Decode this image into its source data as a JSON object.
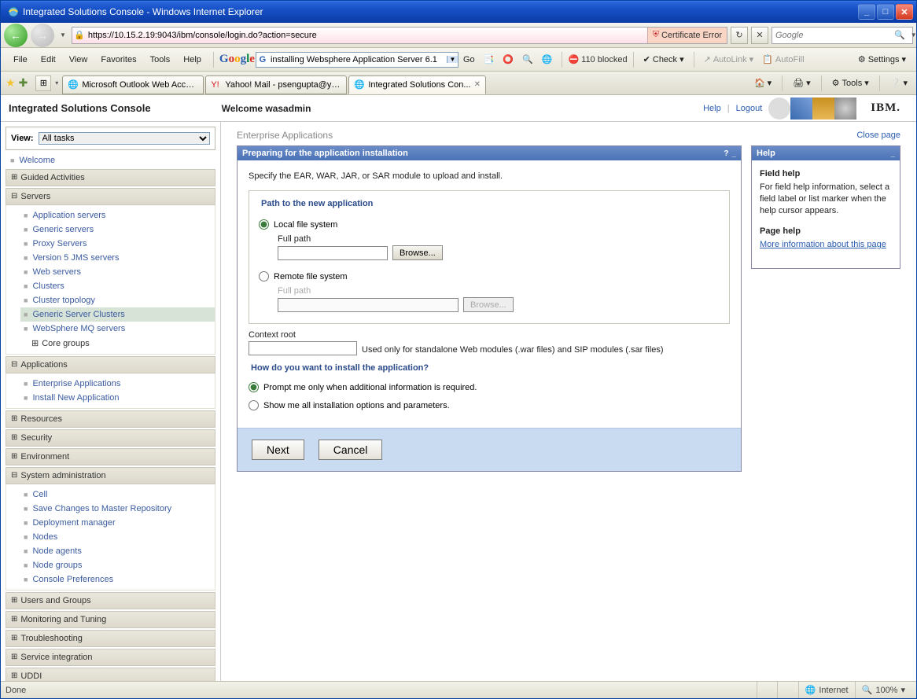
{
  "window": {
    "title": "Integrated Solutions Console - Windows Internet Explorer"
  },
  "address": {
    "url": "https://10.15.2.19:9043/ibm/console/login.do?action=secure",
    "cert_error": "Certificate Error",
    "search_placeholder": "Google"
  },
  "menubar": {
    "items": [
      "File",
      "Edit",
      "View",
      "Favorites",
      "Tools",
      "Help"
    ],
    "google_search_value": "installing Websphere Application Server 6.1",
    "go": "Go",
    "popup_count": "110 blocked",
    "check": "Check",
    "autolink": "AutoLink",
    "autofill": "AutoFill",
    "settings": "Settings"
  },
  "tabs": [
    {
      "label": "Microsoft Outlook Web Access"
    },
    {
      "label": "Yahoo! Mail - psengupta@ya..."
    },
    {
      "label": "Integrated Solutions Con..."
    }
  ],
  "tabs_tools": {
    "tools": "Tools"
  },
  "console": {
    "title": "Integrated Solutions Console",
    "welcome": "Welcome wasadmin",
    "help": "Help",
    "logout": "Logout",
    "ibm": "IBM."
  },
  "sidebar": {
    "view_label": "View:",
    "view_value": "All tasks",
    "welcome": "Welcome",
    "groups": {
      "guided": "Guided Activities",
      "servers": "Servers",
      "applications": "Applications",
      "resources": "Resources",
      "security": "Security",
      "environment": "Environment",
      "sysadmin": "System administration",
      "users_groups": "Users and Groups",
      "monitoring": "Monitoring and Tuning",
      "troubleshooting": "Troubleshooting",
      "service_integration": "Service integration",
      "uddi": "UDDI"
    },
    "servers_items": [
      "Application servers",
      "Generic servers",
      "Proxy Servers",
      "Version 5 JMS servers",
      "Web servers",
      "Clusters",
      "Cluster topology",
      "Generic Server Clusters",
      "WebSphere MQ servers"
    ],
    "core_groups": "Core groups",
    "applications_items": [
      "Enterprise Applications",
      "Install New Application"
    ],
    "sysadmin_items": [
      "Cell",
      "Save Changes to Master Repository",
      "Deployment manager",
      "Nodes",
      "Node agents",
      "Node groups",
      "Console Preferences"
    ]
  },
  "main": {
    "breadcrumb": "Enterprise Applications",
    "close_page": "Close page",
    "panel_title": "Preparing for the application installation",
    "instruction": "Specify the EAR, WAR, JAR, or SAR module to upload and install.",
    "path_legend": "Path to the new application",
    "local_fs": "Local file system",
    "remote_fs": "Remote file system",
    "full_path": "Full path",
    "browse": "Browse...",
    "context_root": "Context root",
    "context_hint": "Used only for standalone Web modules (.war files) and SIP modules (.sar files)",
    "install_legend": "How do you want to install the application?",
    "opt_prompt": "Prompt me only when additional information is required.",
    "opt_show_all": "Show me all installation options and parameters.",
    "next": "Next",
    "cancel": "Cancel"
  },
  "help_panel": {
    "title": "Help",
    "field_help_h": "Field help",
    "field_help_t": "For field help information, select a field label or list marker when the help cursor appears.",
    "page_help_h": "Page help",
    "page_help_link": "More information about this page"
  },
  "statusbar": {
    "done": "Done",
    "zone": "Internet",
    "zoom": "100%"
  }
}
